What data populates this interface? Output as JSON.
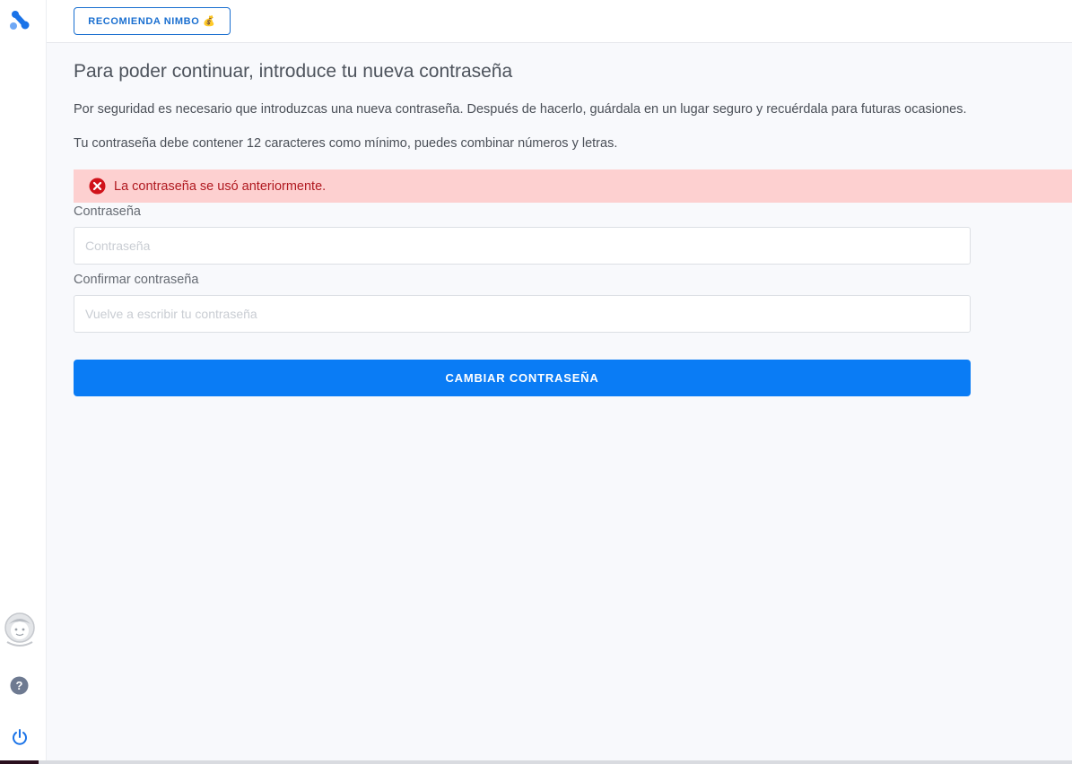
{
  "topbar": {
    "recommend_label": "RECOMIENDA NIMBO",
    "recommend_icon": "money-bag-icon"
  },
  "main": {
    "title": "Para poder continuar, introduce tu nueva contraseña",
    "paragraph_1": "Por seguridad es necesario que introduzcas una nueva contraseña. Después de hacerlo, guárdala en un lugar seguro y recuérdala para futuras ocasiones.",
    "paragraph_2": "Tu contraseña debe contener 12 caracteres como mínimo, puedes combinar números y letras.",
    "alert": {
      "text": "La contraseña se usó anteriormente.",
      "icon": "error-x-icon",
      "color": "#b0181f"
    },
    "password": {
      "label": "Contraseña",
      "value": "",
      "placeholder": "Contraseña"
    },
    "confirm": {
      "label": "Confirmar contraseña",
      "value": "",
      "placeholder": "Vuelve a escribir tu contraseña"
    },
    "submit_label": "CAMBIAR CONTRASEÑA"
  },
  "sidebar": {
    "icons": [
      "logo-icon",
      "avatar-icon",
      "help-icon",
      "power-icon"
    ]
  },
  "colors": {
    "accent": "#0a7cf5",
    "alert_bg": "#fdd0d0"
  }
}
